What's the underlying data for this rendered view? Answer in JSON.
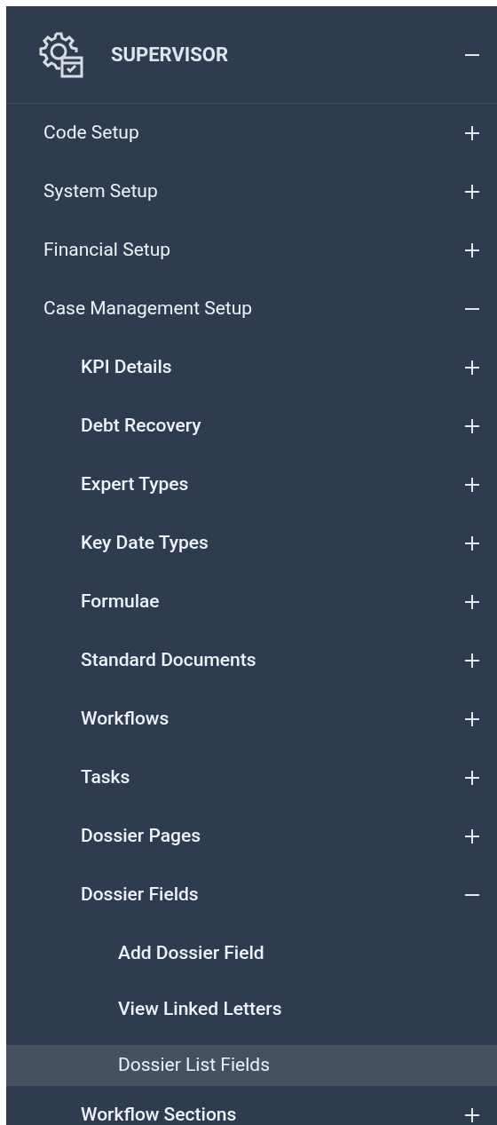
{
  "section": {
    "title": "SUPERVISOR",
    "expanded": true
  },
  "items": [
    {
      "label": "Code Setup",
      "expanded": false
    },
    {
      "label": "System Setup",
      "expanded": false
    },
    {
      "label": "Financial Setup",
      "expanded": false
    },
    {
      "label": "Case Management Setup",
      "expanded": true,
      "children": [
        {
          "label": "KPI Details",
          "expanded": false
        },
        {
          "label": "Debt Recovery",
          "expanded": false
        },
        {
          "label": "Expert Types",
          "expanded": false
        },
        {
          "label": "Key Date Types",
          "expanded": false
        },
        {
          "label": "Formulae",
          "expanded": false
        },
        {
          "label": "Standard Documents",
          "expanded": false
        },
        {
          "label": "Workflows",
          "expanded": false
        },
        {
          "label": "Tasks",
          "expanded": false
        },
        {
          "label": "Dossier Pages",
          "expanded": false
        },
        {
          "label": "Dossier Fields",
          "expanded": true,
          "children": [
            {
              "label": "Add Dossier Field",
              "selected": false
            },
            {
              "label": "View Linked Letters",
              "selected": false
            },
            {
              "label": "Dossier List Fields",
              "selected": true
            }
          ]
        },
        {
          "label": "Workflow Sections",
          "expanded": false
        }
      ]
    }
  ]
}
